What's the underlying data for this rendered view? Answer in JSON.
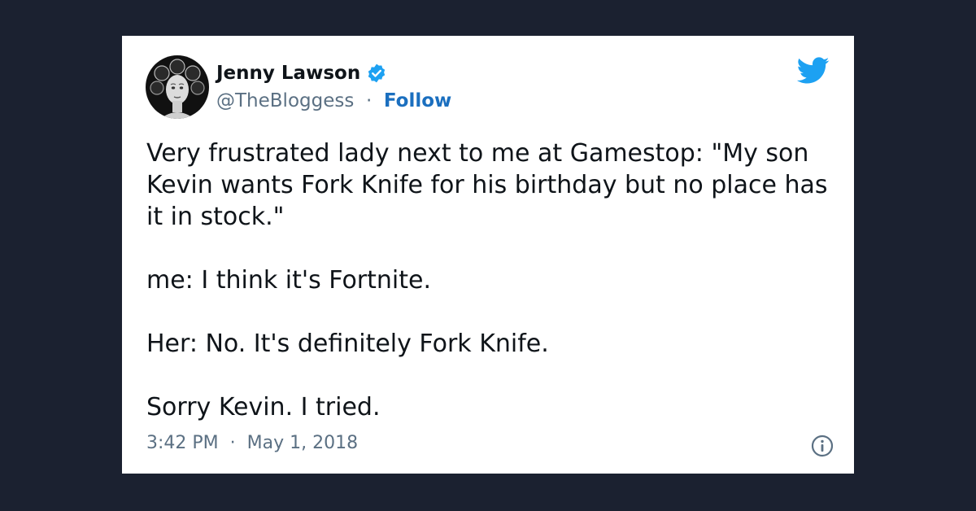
{
  "author": {
    "name": "Jenny Lawson",
    "handle": "@TheBloggess",
    "separator": "·",
    "follow_label": "Follow"
  },
  "tweet": {
    "paragraphs": [
      "Very frustrated lady next to me at Gamestop:  \"My son Kevin wants Fork Knife for his birthday but no place has it in stock.\"",
      "me: I think it's Fortnite.",
      "Her:  No.  It's definitely Fork Knife.",
      "Sorry Kevin.  I tried."
    ]
  },
  "meta": {
    "time": "3:42 PM",
    "separator": "·",
    "date": "May 1, 2018"
  },
  "icons": {
    "verified": "verified-badge-icon",
    "brand": "twitter-bird-icon",
    "info": "info-icon"
  },
  "colors": {
    "background": "#1b2130",
    "card": "#ffffff",
    "text": "#0f1419",
    "muted": "#5b7083",
    "follow": "#1b6fbf",
    "twitter_blue": "#1da1f2"
  }
}
